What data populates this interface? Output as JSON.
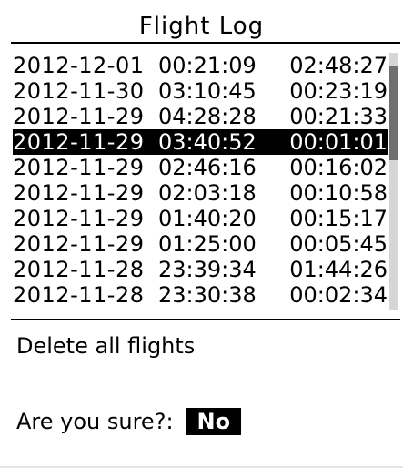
{
  "header": {
    "title": "Flight Log"
  },
  "flights": [
    {
      "date": "2012-12-01",
      "start": "00:21:09",
      "duration": "02:48:27",
      "selected": false
    },
    {
      "date": "2012-11-30",
      "start": "03:10:45",
      "duration": "00:23:19",
      "selected": false
    },
    {
      "date": "2012-11-29",
      "start": "04:28:28",
      "duration": "00:21:33",
      "selected": false
    },
    {
      "date": "2012-11-29",
      "start": "03:40:52",
      "duration": "00:01:01",
      "selected": true
    },
    {
      "date": "2012-11-29",
      "start": "02:46:16",
      "duration": "00:16:02",
      "selected": false
    },
    {
      "date": "2012-11-29",
      "start": "02:03:18",
      "duration": "00:10:58",
      "selected": false
    },
    {
      "date": "2012-11-29",
      "start": "01:40:20",
      "duration": "00:15:17",
      "selected": false
    },
    {
      "date": "2012-11-29",
      "start": "01:25:00",
      "duration": "00:05:45",
      "selected": false
    },
    {
      "date": "2012-11-28",
      "start": "23:39:34",
      "duration": "01:44:26",
      "selected": false
    },
    {
      "date": "2012-11-28",
      "start": "23:30:38",
      "duration": "00:02:34",
      "selected": false
    }
  ],
  "actions": {
    "delete_label": "Delete all flights"
  },
  "confirm": {
    "prompt": "Are you sure?:",
    "value": "No"
  },
  "colors": {
    "foreground": "#000000",
    "background": "#ffffff",
    "scroll_track": "#d6d6d6",
    "scroll_thumb": "#6f6f6f"
  }
}
